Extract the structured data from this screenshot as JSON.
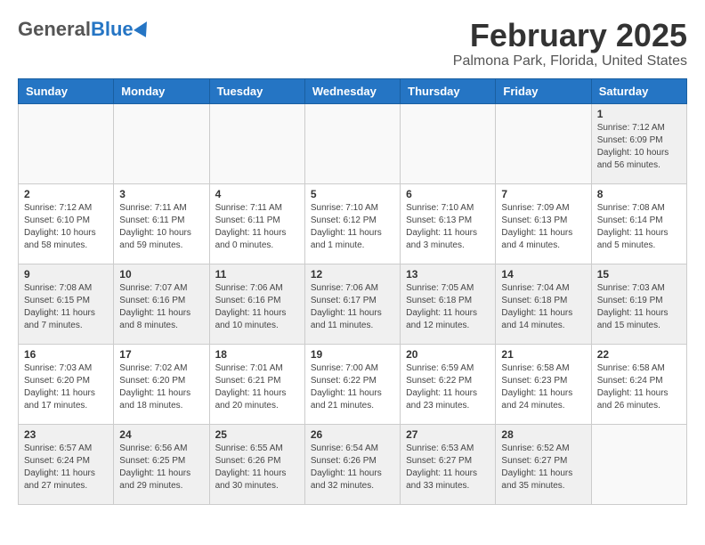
{
  "header": {
    "logo_general": "General",
    "logo_blue": "Blue",
    "month_title": "February 2025",
    "location": "Palmona Park, Florida, United States"
  },
  "days_of_week": [
    "Sunday",
    "Monday",
    "Tuesday",
    "Wednesday",
    "Thursday",
    "Friday",
    "Saturday"
  ],
  "weeks": [
    [
      {
        "day": "",
        "info": ""
      },
      {
        "day": "",
        "info": ""
      },
      {
        "day": "",
        "info": ""
      },
      {
        "day": "",
        "info": ""
      },
      {
        "day": "",
        "info": ""
      },
      {
        "day": "",
        "info": ""
      },
      {
        "day": "1",
        "info": "Sunrise: 7:12 AM\nSunset: 6:09 PM\nDaylight: 10 hours and 56 minutes."
      }
    ],
    [
      {
        "day": "2",
        "info": "Sunrise: 7:12 AM\nSunset: 6:10 PM\nDaylight: 10 hours and 58 minutes."
      },
      {
        "day": "3",
        "info": "Sunrise: 7:11 AM\nSunset: 6:11 PM\nDaylight: 10 hours and 59 minutes."
      },
      {
        "day": "4",
        "info": "Sunrise: 7:11 AM\nSunset: 6:11 PM\nDaylight: 11 hours and 0 minutes."
      },
      {
        "day": "5",
        "info": "Sunrise: 7:10 AM\nSunset: 6:12 PM\nDaylight: 11 hours and 1 minute."
      },
      {
        "day": "6",
        "info": "Sunrise: 7:10 AM\nSunset: 6:13 PM\nDaylight: 11 hours and 3 minutes."
      },
      {
        "day": "7",
        "info": "Sunrise: 7:09 AM\nSunset: 6:13 PM\nDaylight: 11 hours and 4 minutes."
      },
      {
        "day": "8",
        "info": "Sunrise: 7:08 AM\nSunset: 6:14 PM\nDaylight: 11 hours and 5 minutes."
      }
    ],
    [
      {
        "day": "9",
        "info": "Sunrise: 7:08 AM\nSunset: 6:15 PM\nDaylight: 11 hours and 7 minutes."
      },
      {
        "day": "10",
        "info": "Sunrise: 7:07 AM\nSunset: 6:16 PM\nDaylight: 11 hours and 8 minutes."
      },
      {
        "day": "11",
        "info": "Sunrise: 7:06 AM\nSunset: 6:16 PM\nDaylight: 11 hours and 10 minutes."
      },
      {
        "day": "12",
        "info": "Sunrise: 7:06 AM\nSunset: 6:17 PM\nDaylight: 11 hours and 11 minutes."
      },
      {
        "day": "13",
        "info": "Sunrise: 7:05 AM\nSunset: 6:18 PM\nDaylight: 11 hours and 12 minutes."
      },
      {
        "day": "14",
        "info": "Sunrise: 7:04 AM\nSunset: 6:18 PM\nDaylight: 11 hours and 14 minutes."
      },
      {
        "day": "15",
        "info": "Sunrise: 7:03 AM\nSunset: 6:19 PM\nDaylight: 11 hours and 15 minutes."
      }
    ],
    [
      {
        "day": "16",
        "info": "Sunrise: 7:03 AM\nSunset: 6:20 PM\nDaylight: 11 hours and 17 minutes."
      },
      {
        "day": "17",
        "info": "Sunrise: 7:02 AM\nSunset: 6:20 PM\nDaylight: 11 hours and 18 minutes."
      },
      {
        "day": "18",
        "info": "Sunrise: 7:01 AM\nSunset: 6:21 PM\nDaylight: 11 hours and 20 minutes."
      },
      {
        "day": "19",
        "info": "Sunrise: 7:00 AM\nSunset: 6:22 PM\nDaylight: 11 hours and 21 minutes."
      },
      {
        "day": "20",
        "info": "Sunrise: 6:59 AM\nSunset: 6:22 PM\nDaylight: 11 hours and 23 minutes."
      },
      {
        "day": "21",
        "info": "Sunrise: 6:58 AM\nSunset: 6:23 PM\nDaylight: 11 hours and 24 minutes."
      },
      {
        "day": "22",
        "info": "Sunrise: 6:58 AM\nSunset: 6:24 PM\nDaylight: 11 hours and 26 minutes."
      }
    ],
    [
      {
        "day": "23",
        "info": "Sunrise: 6:57 AM\nSunset: 6:24 PM\nDaylight: 11 hours and 27 minutes."
      },
      {
        "day": "24",
        "info": "Sunrise: 6:56 AM\nSunset: 6:25 PM\nDaylight: 11 hours and 29 minutes."
      },
      {
        "day": "25",
        "info": "Sunrise: 6:55 AM\nSunset: 6:26 PM\nDaylight: 11 hours and 30 minutes."
      },
      {
        "day": "26",
        "info": "Sunrise: 6:54 AM\nSunset: 6:26 PM\nDaylight: 11 hours and 32 minutes."
      },
      {
        "day": "27",
        "info": "Sunrise: 6:53 AM\nSunset: 6:27 PM\nDaylight: 11 hours and 33 minutes."
      },
      {
        "day": "28",
        "info": "Sunrise: 6:52 AM\nSunset: 6:27 PM\nDaylight: 11 hours and 35 minutes."
      },
      {
        "day": "",
        "info": ""
      }
    ]
  ]
}
